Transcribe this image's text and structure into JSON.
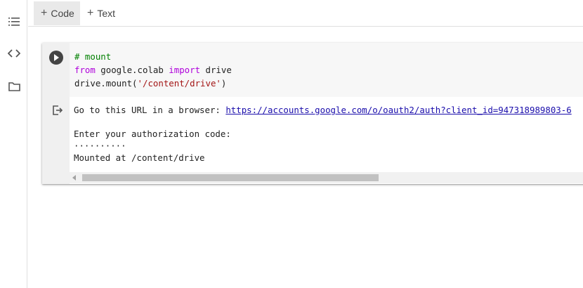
{
  "rail": {
    "icons": [
      "table-of-contents-icon",
      "code-snippets-icon",
      "files-icon"
    ]
  },
  "toolbar": {
    "code_label": "Code",
    "text_label": "Text",
    "plus_glyph": "+"
  },
  "cell": {
    "code": {
      "line1": "# mount",
      "line2_kw1": "from",
      "line2_mod": " google.colab ",
      "line2_kw2": "import",
      "line2_name": " drive",
      "line3_pre": "drive.mount(",
      "line3_str": "'/content/drive'",
      "line3_post": ")"
    },
    "output": {
      "url_prompt": "Go to this URL in a browser: ",
      "url_link": "https://accounts.google.com/o/oauth2/auth?client_id=947318989803-6",
      "auth_prompt": "Enter your authorization code:",
      "masked_code": "··········",
      "mounted": "Mounted at /content/drive"
    }
  },
  "colors": {
    "comment": "#008000",
    "keyword": "#af00db",
    "string": "#a31515",
    "link": "#1a0dab",
    "run_button": "#444444"
  }
}
